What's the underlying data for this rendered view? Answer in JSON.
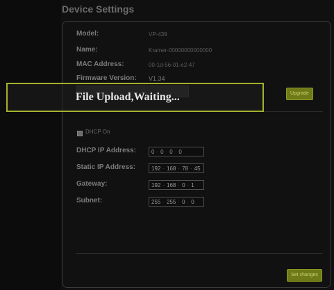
{
  "page_title": "Device Settings",
  "info": [
    {
      "label": "Model:",
      "value": "VP-439"
    },
    {
      "label": "Name:",
      "value": "Kramer-00000000000000"
    },
    {
      "label": "MAC Address:",
      "value": "00-1d-56-01-e2-47"
    },
    {
      "label": "Firmware Version:",
      "value": "V1.34"
    }
  ],
  "upgrade_label": "Upgrade",
  "overlay_message": "File Upload,Waiting...",
  "dhcp_label": "DHCP On",
  "network": [
    {
      "label": "DHCP IP Address:",
      "octets": [
        "0",
        "0",
        "0",
        "0"
      ]
    },
    {
      "label": "Static IP Address:",
      "octets": [
        "192",
        "168",
        "78",
        "45"
      ]
    },
    {
      "label": "Gateway:",
      "octets": [
        "192",
        "168",
        "0",
        "1"
      ]
    },
    {
      "label": "Subnet:",
      "octets": [
        "255",
        "255",
        "0",
        "0"
      ]
    }
  ],
  "set_changes_label": "Set changes"
}
